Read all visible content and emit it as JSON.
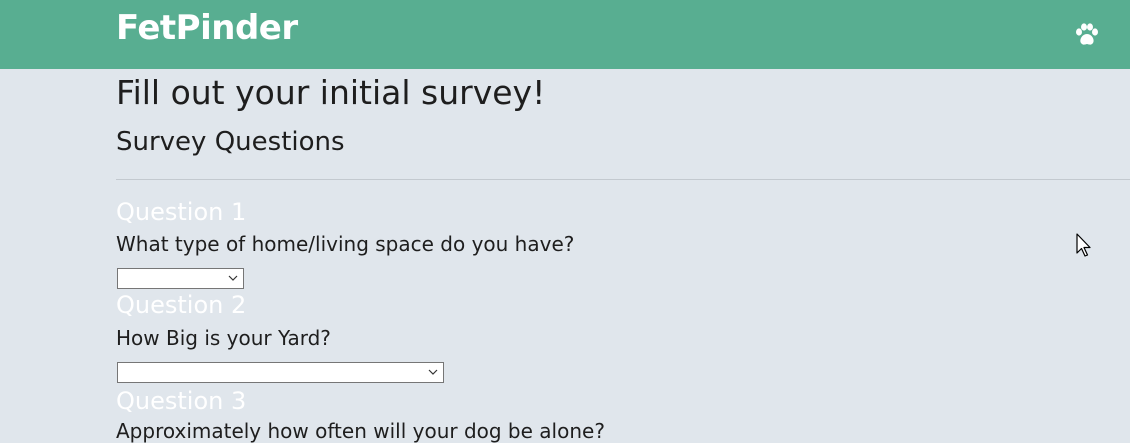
{
  "header": {
    "brand": "FetPinder",
    "icon": "paw-icon",
    "brand_color": "#58ae91"
  },
  "page": {
    "title": "Fill out your initial survey!",
    "section_title": "Survey Questions",
    "background": "#e0e6ec"
  },
  "questions": [
    {
      "heading": "Question 1",
      "text": "What type of home/living space do you have?",
      "selected": ""
    },
    {
      "heading": "Question 2",
      "text": "How Big is your Yard?",
      "selected": ""
    },
    {
      "heading": "Question 3",
      "text": "Approximately how often will your dog be alone?"
    }
  ],
  "icons": {
    "select_chevron": "chevron-down-icon",
    "pointer": "mouse-cursor-icon"
  }
}
